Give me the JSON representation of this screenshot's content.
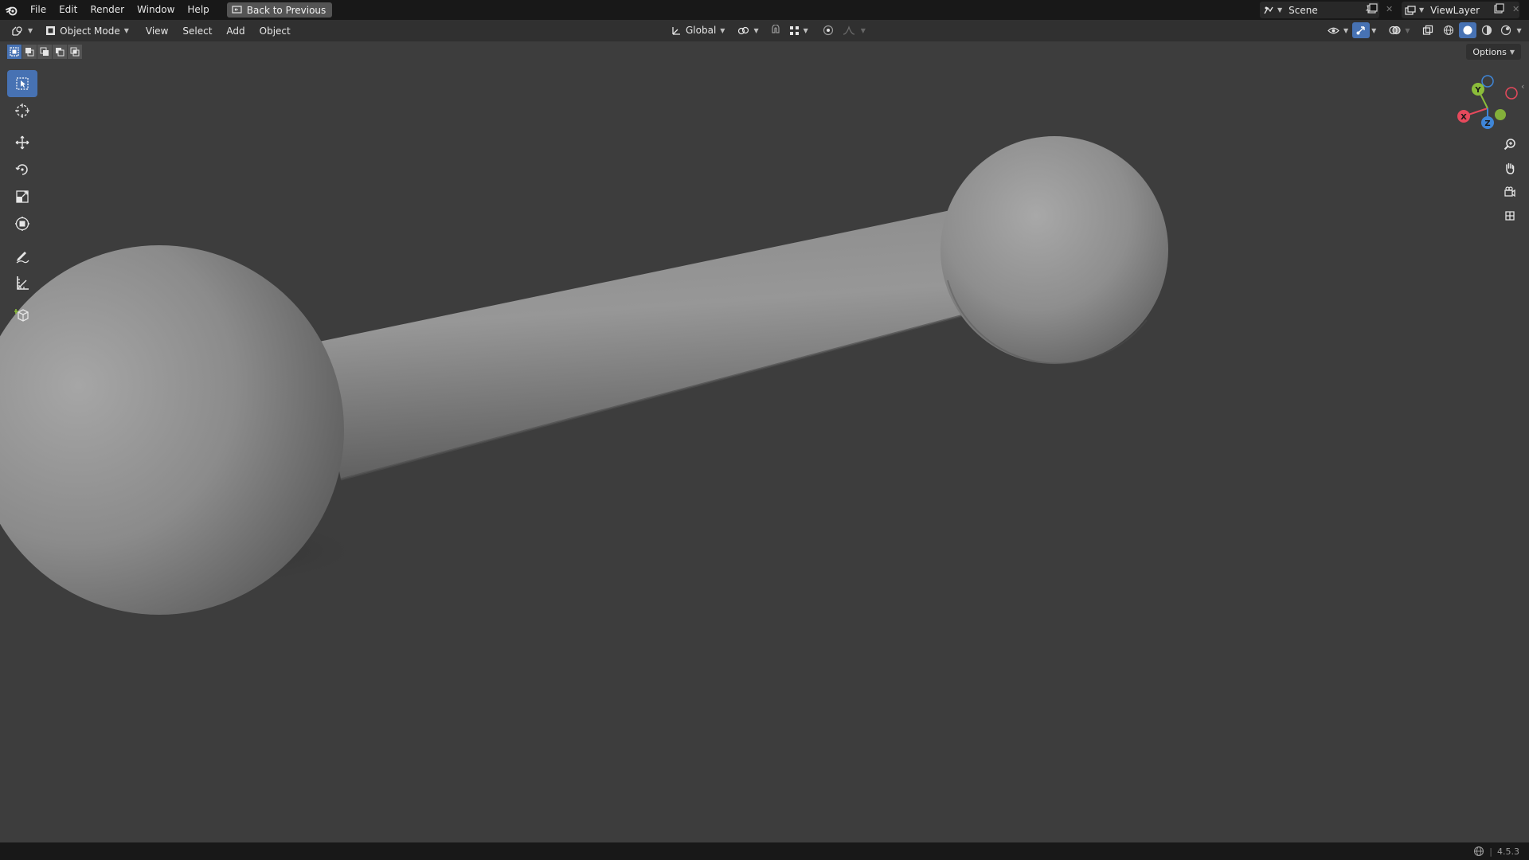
{
  "topbar": {
    "menus": [
      "File",
      "Edit",
      "Render",
      "Window",
      "Help"
    ],
    "back_button": "Back to Previous",
    "scene_name": "Scene",
    "view_layer_name": "ViewLayer"
  },
  "header": {
    "mode": "Object Mode",
    "menus": [
      "View",
      "Select",
      "Add",
      "Object"
    ],
    "orientation": "Global",
    "options_label": "Options"
  },
  "gizmo": {
    "x_label": "X",
    "y_label": "Y",
    "z_label": "Z"
  },
  "status": {
    "version": "4.5.3"
  },
  "colors": {
    "accent": "#4772b3",
    "axis_x": "#e6495c",
    "axis_y": "#8bbd3a",
    "axis_z": "#3f86d8"
  }
}
